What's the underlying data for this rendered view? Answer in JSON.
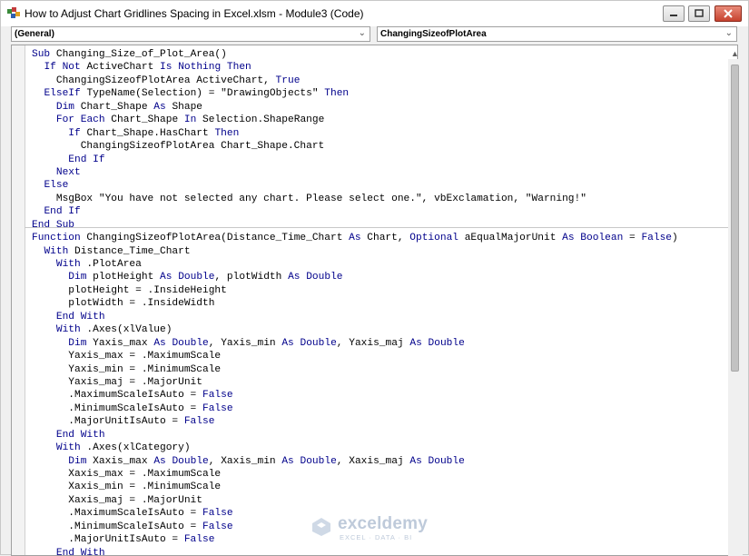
{
  "window": {
    "title": "How to Adjust Chart Gridlines Spacing in Excel.xlsm - Module3 (Code)",
    "controls": {
      "minimize": "minimize",
      "maximize": "maximize",
      "close": "close"
    }
  },
  "combos": {
    "object": "(General)",
    "procedure": "ChangingSizeofPlotArea"
  },
  "code_lines": [
    "Sub Changing_Size_of_Plot_Area()",
    "  If Not ActiveChart Is Nothing Then",
    "    ChangingSizeofPlotArea ActiveChart, True",
    "  ElseIf TypeName(Selection) = \"DrawingObjects\" Then",
    "    Dim Chart_Shape As Shape",
    "    For Each Chart_Shape In Selection.ShapeRange",
    "      If Chart_Shape.HasChart Then",
    "        ChangingSizeofPlotArea Chart_Shape.Chart",
    "      End If",
    "    Next",
    "  Else",
    "    MsgBox \"You have not selected any chart. Please select one.\", vbExclamation, \"Warning!\"",
    "  End If",
    "End Sub",
    "Function ChangingSizeofPlotArea(Distance_Time_Chart As Chart, Optional aEqualMajorUnit As Boolean = False)",
    "  With Distance_Time_Chart",
    "    With .PlotArea",
    "      Dim plotHeight As Double, plotWidth As Double",
    "      plotHeight = .InsideHeight",
    "      plotWidth = .InsideWidth",
    "    End With",
    "    With .Axes(xlValue)",
    "      Dim Yaxis_max As Double, Yaxis_min As Double, Yaxis_maj As Double",
    "      Yaxis_max = .MaximumScale",
    "      Yaxis_min = .MinimumScale",
    "      Yaxis_maj = .MajorUnit",
    "      .MaximumScaleIsAuto = False",
    "      .MinimumScaleIsAuto = False",
    "      .MajorUnitIsAuto = False",
    "    End With",
    "    With .Axes(xlCategory)",
    "      Dim Xaxis_max As Double, Xaxis_min As Double, Xaxis_maj As Double",
    "      Xaxis_max = .MaximumScale",
    "      Xaxis_min = .MinimumScale",
    "      Xaxis_maj = .MajorUnit",
    "      .MaximumScaleIsAuto = False",
    "      .MinimumScaleIsAuto = False",
    "      .MajorUnitIsAuto = False",
    "    End With"
  ],
  "keywords": [
    "Sub",
    "End Sub",
    "If",
    "Not",
    "Is",
    "Nothing",
    "Then",
    "True",
    "False",
    "ElseIf",
    "Dim",
    "As",
    "For",
    "Each",
    "In",
    "End If",
    "Next",
    "Else",
    "Function",
    "Optional",
    "Boolean",
    "Double",
    "With",
    "End With"
  ],
  "colors": {
    "keyword": "#00008b",
    "text": "#000000",
    "separator": "#c8c8c8"
  },
  "watermark": {
    "name": "exceldemy",
    "tagline": "EXCEL · DATA · BI"
  }
}
